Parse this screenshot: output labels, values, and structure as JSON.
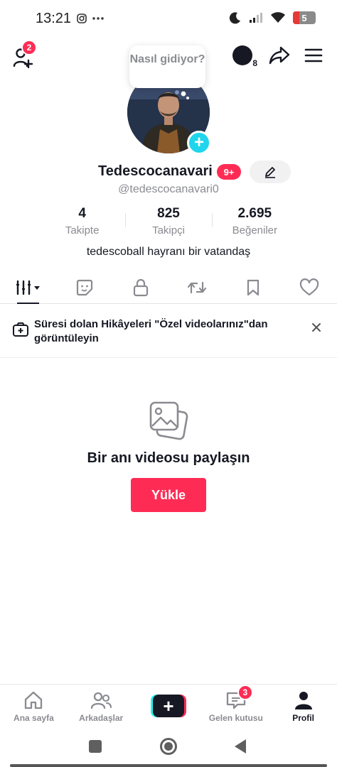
{
  "status_bar": {
    "time": "13:21",
    "battery": "5",
    "icons": [
      "instagram-icon",
      "more-dots-icon",
      "moon-icon",
      "signal-icon",
      "wifi-icon",
      "battery-icon"
    ]
  },
  "top_bar": {
    "friend_requests_count": "2",
    "moon_status_count": "8",
    "icons": [
      "add-friend-icon",
      "moon-status-icon",
      "share-icon",
      "menu-icon"
    ]
  },
  "profile": {
    "speech_bubble": "Nasıl gidiyor?",
    "username": "Tedescocanavari",
    "username_badge": "9+",
    "handle": "@tedescocanavari0",
    "bio": "tedescoball hayranı bir vatandaş"
  },
  "stats": [
    {
      "value": "4",
      "label": "Takipte"
    },
    {
      "value": "825",
      "label": "Takipçi"
    },
    {
      "value": "2.695",
      "label": "Beğeniler"
    }
  ],
  "tabs": [
    "grid-sort-icon",
    "sticker-icon",
    "lock-icon",
    "repost-icon",
    "bookmark-icon",
    "heart-icon"
  ],
  "banner": {
    "text": "Süresi dolan Hikâyeleri \"Özel videolarınız\"dan görüntüleyin"
  },
  "empty_state": {
    "title": "Bir anı videosu paylaşın",
    "button": "Yükle"
  },
  "bottom_nav": {
    "home": "Ana sayfa",
    "friends": "Arkadaşlar",
    "create": "+",
    "inbox": "Gelen kutusu",
    "inbox_count": "3",
    "profile": "Profil",
    "active": "Profil"
  },
  "colors": {
    "brand_red": "#fe2c55",
    "brand_cyan": "#25f4ee",
    "text_primary": "#161823",
    "text_secondary": "#8a8b91"
  }
}
